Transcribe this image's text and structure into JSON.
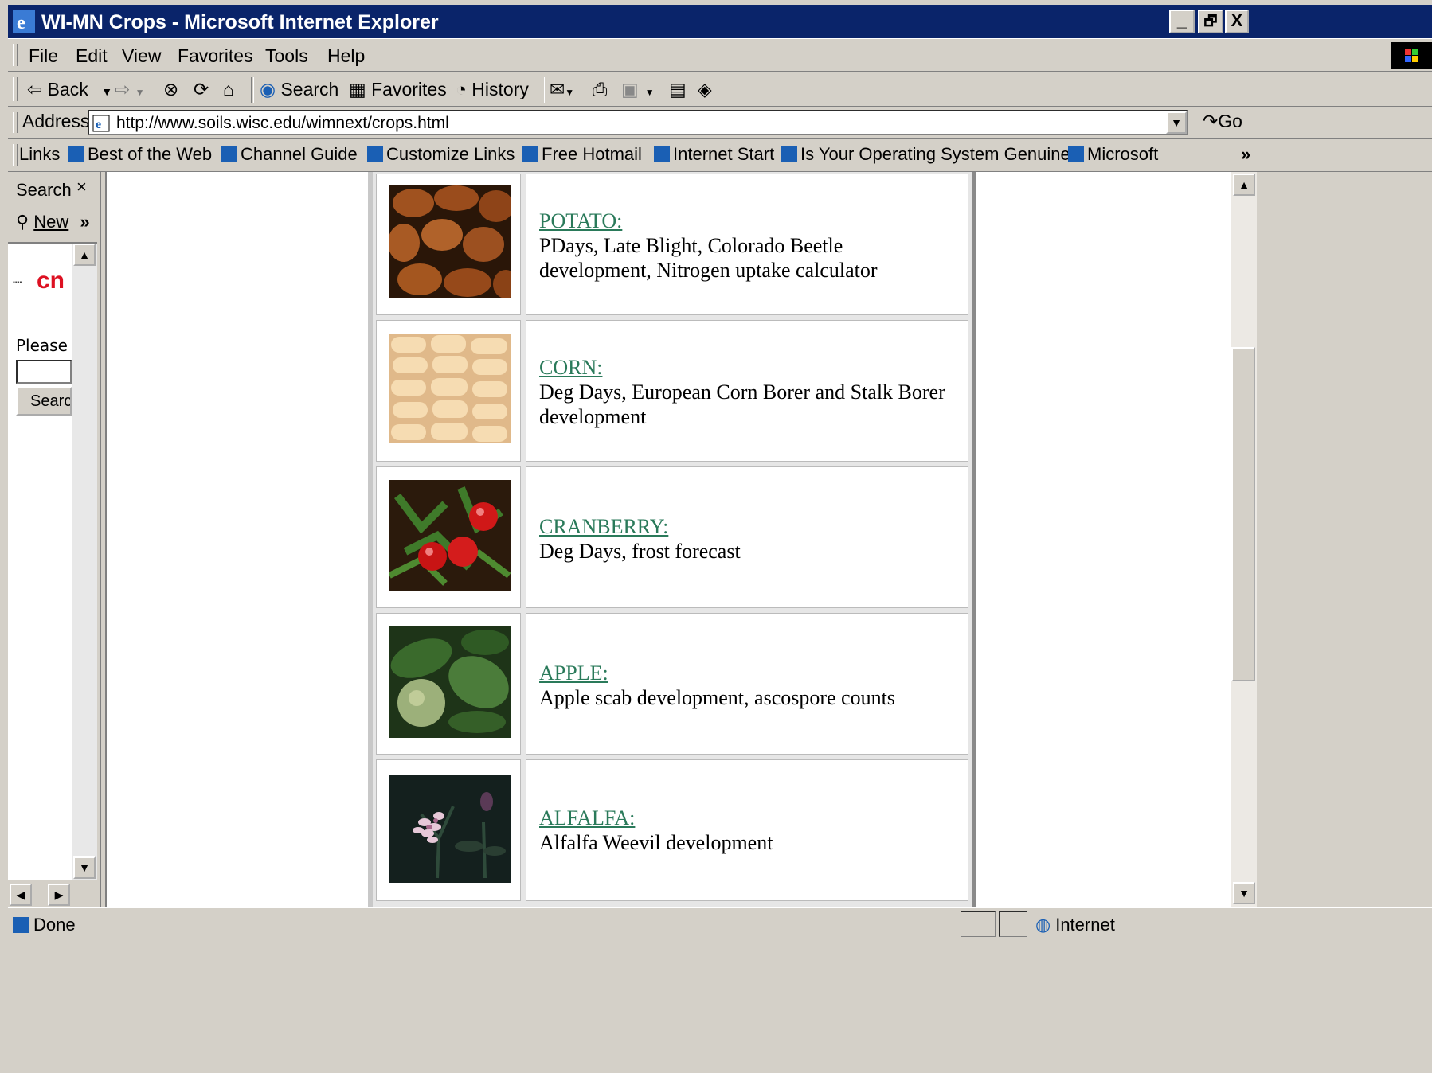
{
  "window": {
    "title": "WI-MN Crops - Microsoft Internet Explorer",
    "controls": {
      "minimize": "_",
      "restore": "🗗",
      "close": "X"
    }
  },
  "menu": [
    "File",
    "Edit",
    "View",
    "Favorites",
    "Tools",
    "Help"
  ],
  "toolbar": {
    "back": "Back",
    "search": "Search",
    "favorites": "Favorites",
    "history": "History"
  },
  "address": {
    "label": "Address",
    "url": "http://www.soils.wisc.edu/wimnext/crops.html",
    "go": "Go"
  },
  "links": {
    "label": "Links",
    "items": [
      "Best of the Web",
      "Channel Guide",
      "Customize Links",
      "Free Hotmail",
      "Internet Start",
      "Is Your Operating System Genuine",
      "Microsoft"
    ],
    "chevron": "»"
  },
  "sidebar": {
    "title": "Search",
    "close": "×",
    "new": "New",
    "more": "»",
    "logo": "cn",
    "please": "Please",
    "button": "Search"
  },
  "crops": [
    {
      "name": "POTATO:",
      "desc": "PDays, Late Blight, Colorado Beetle development, Nitrogen uptake calculator",
      "image": "potato-photo"
    },
    {
      "name": "CORN:",
      "desc": "Deg Days, European Corn Borer and Stalk Borer development",
      "image": "corn-photo"
    },
    {
      "name": "CRANBERRY:",
      "desc": "Deg Days, frost forecast",
      "image": "cranberry-photo"
    },
    {
      "name": "APPLE:",
      "desc": "Apple scab development, ascospore counts",
      "image": "apple-photo"
    },
    {
      "name": "ALFALFA:",
      "desc": "Alfalfa Weevil development",
      "image": "alfalfa-photo"
    }
  ],
  "status": {
    "text": "Done",
    "zone": "Internet"
  },
  "colors": {
    "titlebar": "#0a246a",
    "chrome": "#d4d0c8",
    "link": "#2a7a5a"
  }
}
